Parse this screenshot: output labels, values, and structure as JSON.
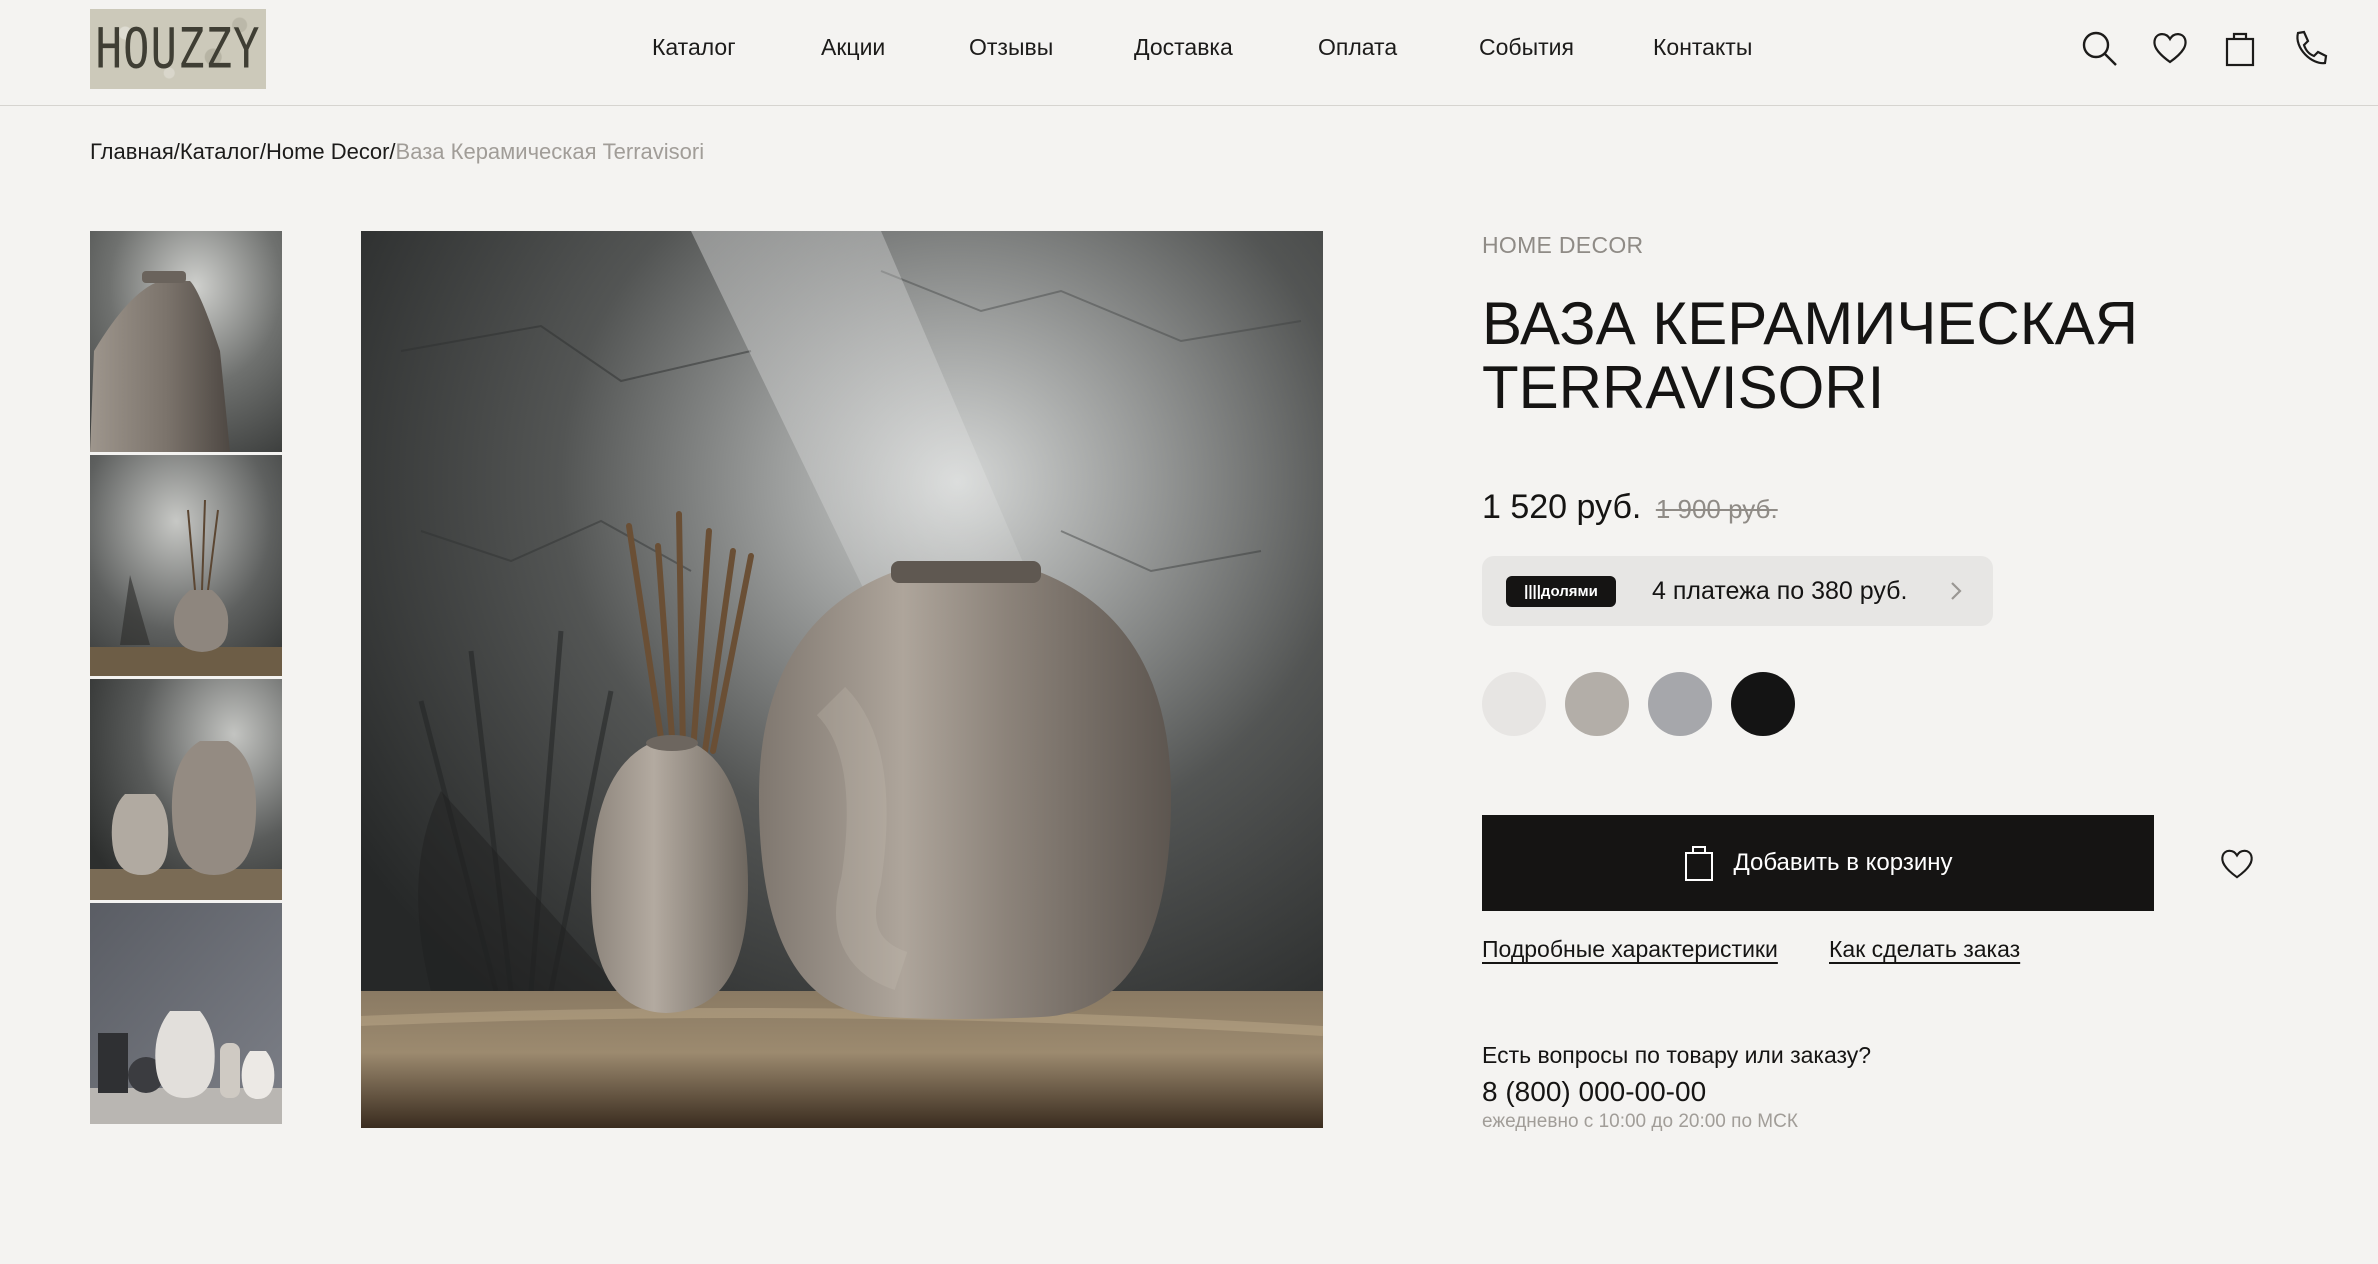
{
  "header": {
    "logo_text": "HOUZZY",
    "nav": [
      "Каталог",
      "Акции",
      "Отзывы",
      "Доставка",
      "Оплата",
      "События",
      "Контакты"
    ],
    "icons": [
      "search-icon",
      "heart-icon",
      "bag-icon",
      "phone-icon"
    ]
  },
  "breadcrumb": {
    "items": [
      "Главная/",
      "Каталог/",
      "Home Decor/"
    ],
    "current": "Ваза Керамическая Terravisori"
  },
  "product": {
    "category": "HOME DECOR",
    "title": "ВАЗА КЕРАМИЧЕСКАЯ TERRAVISORI",
    "price": "1 520 руб.",
    "old_price": "1 900 руб.",
    "installments": {
      "badge": "||||долями",
      "text": "4 платежа по 380 руб."
    },
    "colors": [
      "#e7e5e3",
      "#b3aea8",
      "#a6a7ab",
      "#141414"
    ],
    "add_to_cart": "Добавить в корзину",
    "links": [
      "Подробные характеристики",
      "Как сделать заказ"
    ],
    "support": {
      "question": "Есть вопросы по товару или заказу?",
      "phone": "8 (800) 000-00-00",
      "hours": "ежедневно с 10:00 до 20:00 по МСК"
    }
  }
}
